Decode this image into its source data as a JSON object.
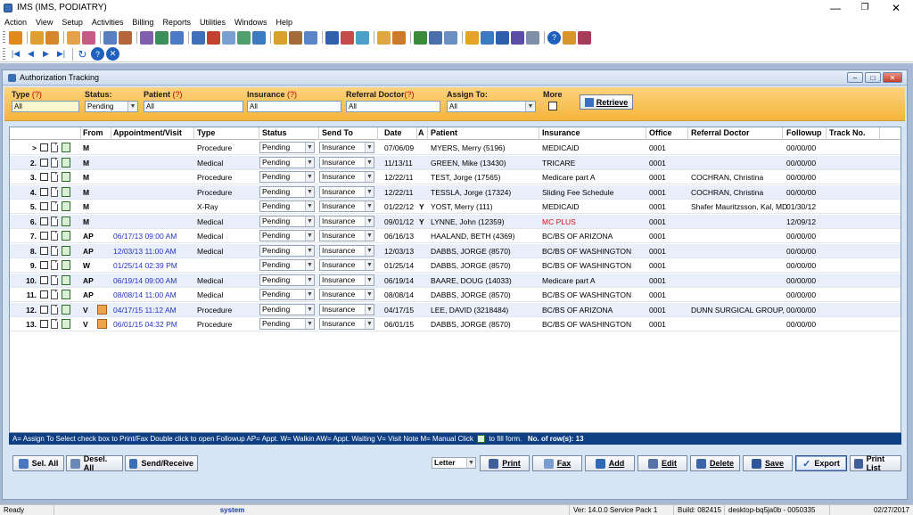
{
  "window": {
    "title": "IMS (IMS, PODIATRY)"
  },
  "menu": [
    "Action",
    "View",
    "Setup",
    "Activities",
    "Billing",
    "Reports",
    "Utilities",
    "Windows",
    "Help"
  ],
  "mdi": {
    "title": "Authorization Tracking"
  },
  "filters": {
    "type": {
      "label": "Type",
      "q": "(?)",
      "value": "All"
    },
    "status": {
      "label": "Status:",
      "value": "Pending"
    },
    "patient": {
      "label": "Patient",
      "q": "(?)",
      "value": "All"
    },
    "insurance": {
      "label": "Insurance",
      "q": "(?)",
      "value": "All"
    },
    "referral": {
      "label": "Referral Doctor",
      "q": "(?)",
      "value": "All"
    },
    "assign": {
      "label": "Assign To:",
      "value": "All"
    },
    "more": {
      "label": "More"
    },
    "retrieve_label": "Retrieve"
  },
  "grid": {
    "headers": [
      "From",
      "Appointment/Visit",
      "Type",
      "Status",
      "Send To",
      "Date",
      "A",
      "Patient",
      "Insurance",
      "Office",
      "Referral Doctor",
      "Followup",
      "Track No."
    ],
    "rows": [
      {
        "num": ">",
        "from": "M",
        "appt": "",
        "type": "Procedure",
        "status": "Pending",
        "sendto": "Insurance",
        "date": "07/06/09",
        "a": "",
        "patient": "MYERS, Merry  (5196)",
        "insurance": "MEDICAID",
        "office": "0001",
        "referral": "",
        "followup": "00/00/00",
        "edit": false,
        "red": false
      },
      {
        "num": "2.",
        "from": "M",
        "appt": "",
        "type": "Medical",
        "status": "Pending",
        "sendto": "Insurance",
        "date": "11/13/11",
        "a": "",
        "patient": "GREEN, Mike  (13430)",
        "insurance": "TRICARE",
        "office": "0001",
        "referral": "",
        "followup": "00/00/00",
        "edit": false,
        "red": false
      },
      {
        "num": "3.",
        "from": "M",
        "appt": "",
        "type": "Procedure",
        "status": "Pending",
        "sendto": "Insurance",
        "date": "12/22/11",
        "a": "",
        "patient": "TEST, Jorge  (17565)",
        "insurance": "Medicare part A",
        "office": "0001",
        "referral": "COCHRAN, Christina",
        "followup": "00/00/00",
        "edit": false,
        "red": false
      },
      {
        "num": "4.",
        "from": "M",
        "appt": "",
        "type": "Procedure",
        "status": "Pending",
        "sendto": "Insurance",
        "date": "12/22/11",
        "a": "",
        "patient": "TESSLA, Jorge  (17324)",
        "insurance": "Sliding Fee Schedule",
        "office": "0001",
        "referral": "COCHRAN, Christina",
        "followup": "00/00/00",
        "edit": false,
        "red": false
      },
      {
        "num": "5.",
        "from": "M",
        "appt": "",
        "type": "X-Ray",
        "status": "Pending",
        "sendto": "Insurance",
        "date": "01/22/12",
        "a": "Y",
        "patient": "YOST, Merry  (111)",
        "insurance": "MEDICAID",
        "office": "0001",
        "referral": "Shafer Mauritzsson, Kal, MD",
        "followup": "01/30/12",
        "edit": false,
        "red": false
      },
      {
        "num": "6.",
        "from": "M",
        "appt": "",
        "type": "Medical",
        "status": "Pending",
        "sendto": "Insurance",
        "date": "09/01/12",
        "a": "Y",
        "patient": "LYNNE, John  (12359)",
        "insurance": "MC PLUS",
        "office": "0001",
        "referral": "",
        "followup": "12/09/12",
        "edit": false,
        "red": true
      },
      {
        "num": "7.",
        "from": "AP",
        "appt": "06/17/13 09:00 AM",
        "type": "Medical",
        "status": "Pending",
        "sendto": "Insurance",
        "date": "06/16/13",
        "a": "",
        "patient": "HAALAND, BETH  (4369)",
        "insurance": "BC/BS OF ARIZONA",
        "office": "0001",
        "referral": "",
        "followup": "00/00/00",
        "edit": false,
        "red": false
      },
      {
        "num": "8.",
        "from": "AP",
        "appt": "12/03/13 11:00 AM",
        "type": "Medical",
        "status": "Pending",
        "sendto": "Insurance",
        "date": "12/03/13",
        "a": "",
        "patient": "DABBS, JORGE  (8570)",
        "insurance": "BC/BS OF WASHINGTON",
        "office": "0001",
        "referral": "",
        "followup": "00/00/00",
        "edit": false,
        "red": false
      },
      {
        "num": "9.",
        "from": "W",
        "appt": "01/25/14 02:39 PM",
        "type": "",
        "status": "Pending",
        "sendto": "Insurance",
        "date": "01/25/14",
        "a": "",
        "patient": "DABBS, JORGE  (8570)",
        "insurance": "BC/BS OF WASHINGTON",
        "office": "0001",
        "referral": "",
        "followup": "00/00/00",
        "edit": false,
        "red": false
      },
      {
        "num": "10.",
        "from": "AP",
        "appt": "06/19/14 09:00 AM",
        "type": "Medical",
        "status": "Pending",
        "sendto": "Insurance",
        "date": "06/19/14",
        "a": "",
        "patient": "BAARE, DOUG  (14033)",
        "insurance": "Medicare part A",
        "office": "0001",
        "referral": "",
        "followup": "00/00/00",
        "edit": false,
        "red": false
      },
      {
        "num": "11.",
        "from": "AP",
        "appt": "08/08/14 11:00 AM",
        "type": "Medical",
        "status": "Pending",
        "sendto": "Insurance",
        "date": "08/08/14",
        "a": "",
        "patient": "DABBS, JORGE  (8570)",
        "insurance": "BC/BS OF WASHINGTON",
        "office": "0001",
        "referral": "",
        "followup": "00/00/00",
        "edit": false,
        "red": false
      },
      {
        "num": "12.",
        "from": "V",
        "appt": "04/17/15 11:12 AM",
        "type": "Procedure",
        "status": "Pending",
        "sendto": "Insurance",
        "date": "04/17/15",
        "a": "",
        "patient": "LEE, DAVID  (3218484)",
        "insurance": "BC/BS OF ARIZONA",
        "office": "0001",
        "referral": "DUNN SURGICAL GROUP,",
        "followup": "00/00/00",
        "edit": true,
        "red": false
      },
      {
        "num": "13.",
        "from": "V",
        "appt": "06/01/15 04:32 PM",
        "type": "Procedure",
        "status": "Pending",
        "sendto": "Insurance",
        "date": "06/01/15",
        "a": "",
        "patient": "DABBS, JORGE  (8570)",
        "insurance": "BC/BS OF WASHINGTON",
        "office": "0001",
        "referral": "",
        "followup": "00/00/00",
        "edit": true,
        "red": false
      }
    ]
  },
  "legend": {
    "text": "A= Assign To   Select check box to Print/Fax   Double click to open Followup   AP= Appt. W= Walkin  AW= Appt. Waiting  V= Visit Note  M= Manual   Click",
    "tail": "to fill form.",
    "rows_label": "No. of row(s): 13"
  },
  "buttons": {
    "sel_all": "Sel. All",
    "desel_all": "Desel. All",
    "send_receive": "Send/Receive",
    "paper": "Letter",
    "print": "Print",
    "fax": "Fax",
    "add": "Add",
    "edit": "Edit",
    "delete": "Delete",
    "save": "Save",
    "export": "Export",
    "print_list": "Print List"
  },
  "status": {
    "ready": "Ready",
    "user": "system",
    "version": "Ver: 14.0.0 Service Pack 1",
    "build": "Build: 082415",
    "machine": "desktop-bq5ja0b - 0050335",
    "date": "02/27/2017"
  }
}
